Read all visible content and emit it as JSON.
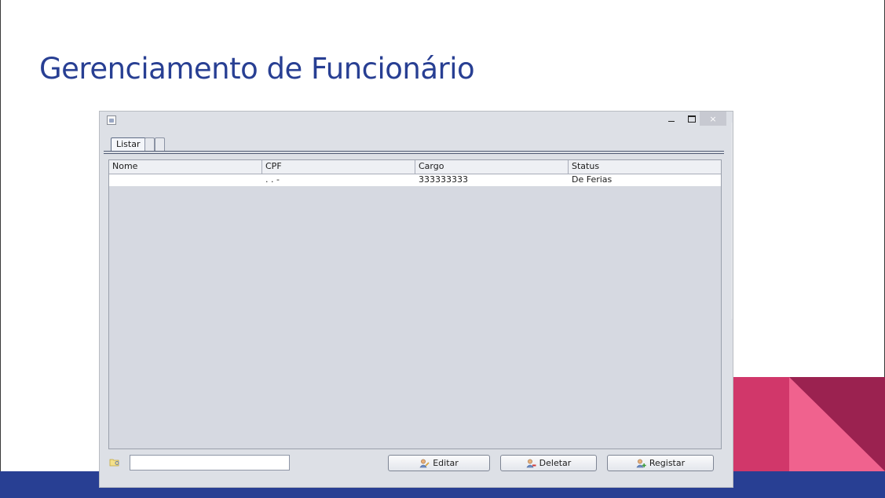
{
  "slide": {
    "title": "Gerenciamento de Funcionário",
    "colors": {
      "title": "#283f93",
      "band": "#283f93",
      "deco_pink": "#f0628e",
      "deco_red": "#d1376a",
      "deco_maroon": "#9b2250"
    }
  },
  "window": {
    "icon": "java-cup-icon",
    "controls": {
      "minimize": "minimize-icon",
      "maximize": "maximize-icon",
      "close": "×"
    },
    "tabs": [
      {
        "label": "Listar",
        "active": true
      },
      {
        "label": "",
        "active": false
      },
      {
        "label": "",
        "active": false
      }
    ],
    "table": {
      "columns": [
        "Nome",
        "CPF",
        "Cargo",
        "Status"
      ],
      "rows": [
        {
          "nome": "",
          "cpf": ". . -",
          "cargo": "333333333",
          "status": "De Ferias"
        }
      ]
    },
    "search": {
      "icon": "folder-search-icon",
      "value": ""
    },
    "buttons": {
      "editar": {
        "label": "Editar",
        "icon": "user-edit-icon"
      },
      "deletar": {
        "label": "Deletar",
        "icon": "user-delete-icon"
      },
      "registar": {
        "label": "Registar",
        "icon": "user-add-icon"
      }
    }
  }
}
